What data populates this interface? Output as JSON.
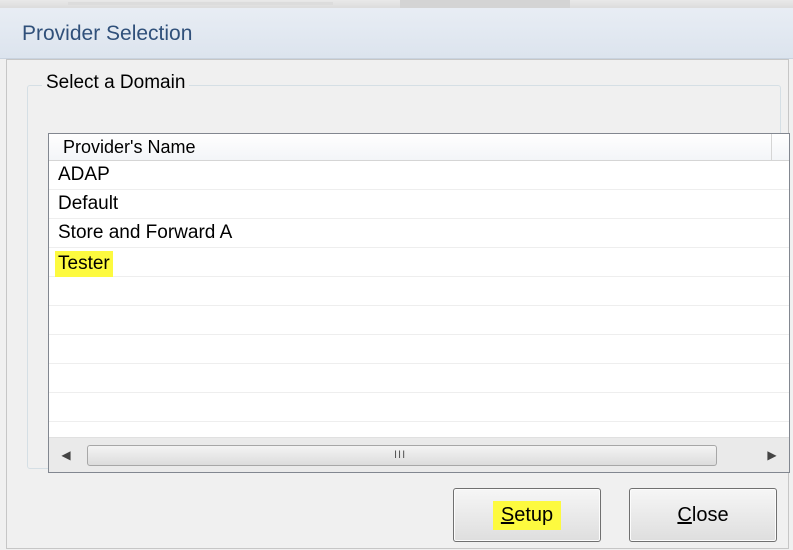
{
  "window": {
    "title": "Provider Selection"
  },
  "group": {
    "label": "Select a Domain"
  },
  "list": {
    "column_header": "Provider's Name",
    "items": [
      "ADAP",
      "Default",
      "Store and Forward A",
      "Tester"
    ]
  },
  "scrollbar": {
    "grip": "III"
  },
  "buttons": {
    "setup_access_key": "S",
    "setup_rest": "etup",
    "close_access_key": "C",
    "close_rest": "lose"
  },
  "colors": {
    "highlight": "#fdfa3f",
    "title_text": "#30507a"
  }
}
